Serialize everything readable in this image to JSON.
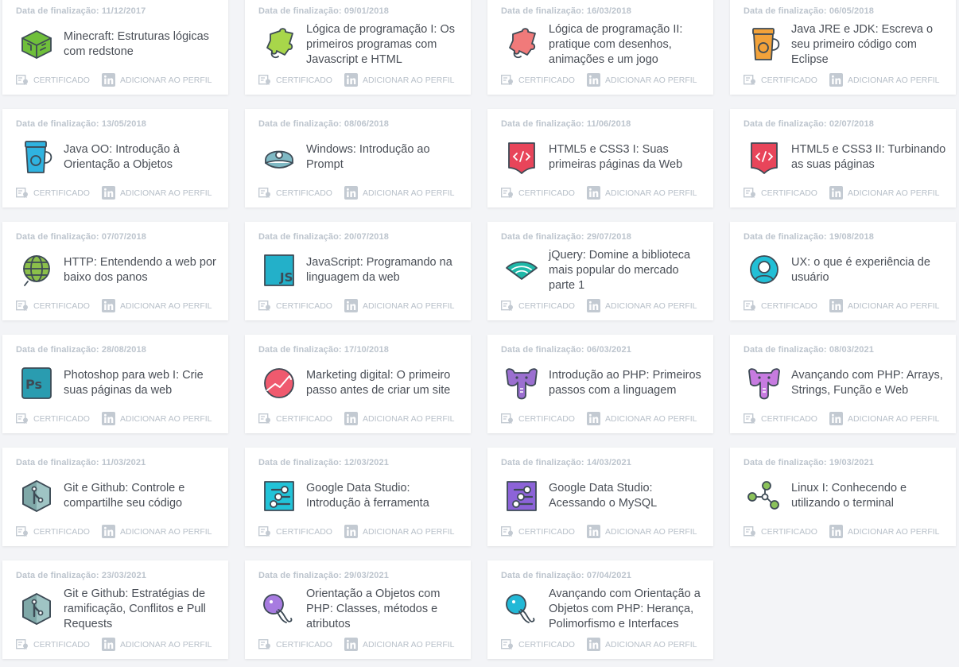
{
  "date_prefix": "Data de finalização:",
  "certificate_label": "CERTIFICADO",
  "profile_label": "ADICIONAR AO PERFIL",
  "courses": [
    {
      "date": "11/12/2017",
      "title": "Minecraft: Estruturas lógicas com redstone",
      "icon": "minecraft-icon",
      "color": "#6fbf3b"
    },
    {
      "date": "09/01/2018",
      "title": "Lógica de programação I: Os primeiros programas com Javascript e HTML",
      "icon": "puzzle-icon",
      "color": "#a8d64a"
    },
    {
      "date": "16/03/2018",
      "title": "Lógica de programação II: pratique com desenhos, animações e um jogo",
      "icon": "puzzle-icon",
      "color": "#f07a7a"
    },
    {
      "date": "06/05/2018",
      "title": "Java JRE e JDK: Escreva o seu primeiro código com Eclipse",
      "icon": "coffee-cup-icon",
      "color": "#f2a23a"
    },
    {
      "date": "13/05/2018",
      "title": "Java OO: Introdução à Orientação a Objetos",
      "icon": "coffee-cup-icon",
      "color": "#2fb3e0"
    },
    {
      "date": "08/06/2018",
      "title": "Windows: Introdução ao Prompt",
      "icon": "cap-icon",
      "color": "#7fb9c4"
    },
    {
      "date": "11/06/2018",
      "title": "HTML5 e CSS3 I: Suas primeiras páginas da Web",
      "icon": "code-page-icon",
      "color": "#e8455a"
    },
    {
      "date": "02/07/2018",
      "title": "HTML5 e CSS3 II: Turbinando as suas páginas",
      "icon": "code-page-icon",
      "color": "#e8455a"
    },
    {
      "date": "07/07/2018",
      "title": "HTTP: Entendendo a web por baixo dos panos",
      "icon": "globe-icon",
      "color": "#8bbf4a"
    },
    {
      "date": "20/07/2018",
      "title": "JavaScript: Programando na linguagem da web",
      "icon": "js-icon",
      "color": "#23b0c9"
    },
    {
      "date": "29/07/2018",
      "title": "jQuery: Domine a biblioteca mais popular do mercado parte 1",
      "icon": "wifi-fan-icon",
      "color": "#1fb8a8"
    },
    {
      "date": "19/08/2018",
      "title": "UX: o que é experiência de usuário",
      "icon": "user-circle-icon",
      "color": "#22bfd6"
    },
    {
      "date": "28/08/2018",
      "title": "Photoshop para web I: Crie suas páginas da web",
      "icon": "photoshop-icon",
      "color": "#2a9cb0"
    },
    {
      "date": "17/10/2018",
      "title": "Marketing digital: O primeiro passo antes de criar um site",
      "icon": "chart-circle-icon",
      "color": "#ef5a6e"
    },
    {
      "date": "06/03/2021",
      "title": "Introdução ao PHP: Primeiros passos com a linguagem",
      "icon": "elephant-icon",
      "color": "#9b6fd0"
    },
    {
      "date": "08/03/2021",
      "title": "Avançando com PHP: Arrays, Strings, Função e Web",
      "icon": "elephant-icon",
      "color": "#c77be0"
    },
    {
      "date": "11/03/2021",
      "title": "Git e Github: Controle e compartilhe seu código",
      "icon": "git-icon",
      "color": "#7fa8a8"
    },
    {
      "date": "12/03/2021",
      "title": "Google Data Studio: Introdução à ferramenta",
      "icon": "data-studio-icon",
      "color": "#22c3d8"
    },
    {
      "date": "14/03/2021",
      "title": "Google Data Studio: Acessando o MySQL",
      "icon": "data-studio-icon",
      "color": "#8c63d8"
    },
    {
      "date": "19/03/2021",
      "title": "Linux I: Conhecendo e utilizando o terminal",
      "icon": "network-icon",
      "color": "#8bc25a"
    },
    {
      "date": "23/03/2021",
      "title": "Git e Github: Estratégias de ramificação, Conflitos e Pull Requests",
      "icon": "git-icon",
      "color": "#7fa8a8"
    },
    {
      "date": "29/03/2021",
      "title": "Orientação a Objetos com PHP: Classes, métodos e atributos",
      "icon": "elephant-head-icon",
      "color": "#a77be0"
    },
    {
      "date": "07/04/2021",
      "title": "Avançando com Orientação a Objetos com PHP: Herança, Polimorfismo e Interfaces",
      "icon": "elephant-head-icon",
      "color": "#22b8d6"
    }
  ]
}
